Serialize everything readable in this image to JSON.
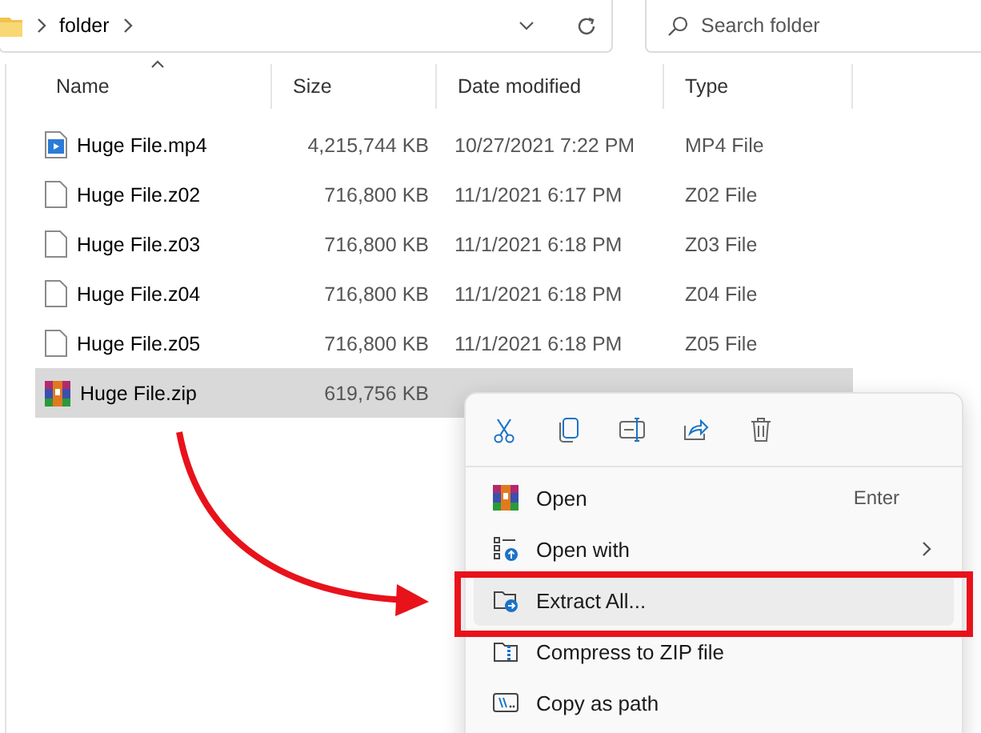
{
  "address_bar": {
    "breadcrumbs": [
      "folder"
    ]
  },
  "search": {
    "placeholder": "Search folder"
  },
  "table": {
    "columns": [
      {
        "label": "Name",
        "sorted": true
      },
      {
        "label": "Size",
        "sorted": false
      },
      {
        "label": "Date modified",
        "sorted": false
      },
      {
        "label": "Type",
        "sorted": false
      }
    ],
    "rows": [
      {
        "kind": "video",
        "name": "Huge File.mp4",
        "size": "4,215,744 KB",
        "date": "10/27/2021 7:22 PM",
        "type": "MP4 File",
        "selected": false
      },
      {
        "kind": "file",
        "name": "Huge File.z02",
        "size": "716,800 KB",
        "date": "11/1/2021 6:17 PM",
        "type": "Z02 File",
        "selected": false
      },
      {
        "kind": "file",
        "name": "Huge File.z03",
        "size": "716,800 KB",
        "date": "11/1/2021 6:18 PM",
        "type": "Z03 File",
        "selected": false
      },
      {
        "kind": "file",
        "name": "Huge File.z04",
        "size": "716,800 KB",
        "date": "11/1/2021 6:18 PM",
        "type": "Z04 File",
        "selected": false
      },
      {
        "kind": "file",
        "name": "Huge File.z05",
        "size": "716,800 KB",
        "date": "11/1/2021 6:18 PM",
        "type": "Z05 File",
        "selected": false
      },
      {
        "kind": "archive",
        "name": "Huge File.zip",
        "size": "619,756 KB",
        "selected": true
      }
    ]
  },
  "context_menu": {
    "items": [
      {
        "label": "Open",
        "shortcut": "Enter",
        "submenu": false,
        "hovered": false,
        "annotated": false
      },
      {
        "label": "Open with",
        "submenu": true,
        "hovered": false,
        "annotated": false
      },
      {
        "label": "Extract All...",
        "submenu": false,
        "hovered": true,
        "annotated": true
      },
      {
        "label": "Compress to ZIP file",
        "submenu": false,
        "hovered": false,
        "annotated": false
      },
      {
        "label": "Copy as path",
        "submenu": false,
        "hovered": false,
        "annotated": false
      }
    ]
  }
}
